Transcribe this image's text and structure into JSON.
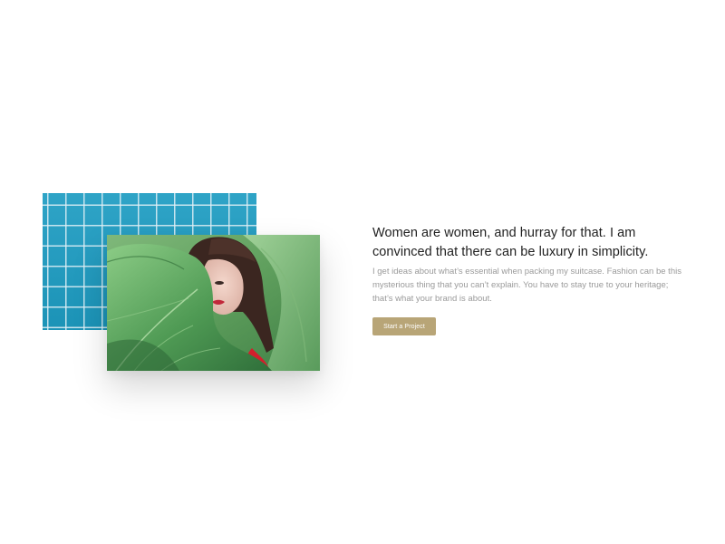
{
  "feature": {
    "images": {
      "back": {
        "name": "blue tiled wall",
        "color": "#1d9cc2"
      },
      "front": {
        "name": "woman behind green leaf",
        "color": "#5f9f5d"
      }
    },
    "headline": "Women are women, and hurray for that. I am convinced that there can be luxury in simplicity.",
    "description": "I get ideas about what’s essential when packing my suitcase. Fashion can be this mysterious thing that you can’t explain. You have to stay true to your heritage; that’s what your brand is about.",
    "cta": {
      "label": "Start a Project",
      "color": "#b8a577"
    }
  }
}
